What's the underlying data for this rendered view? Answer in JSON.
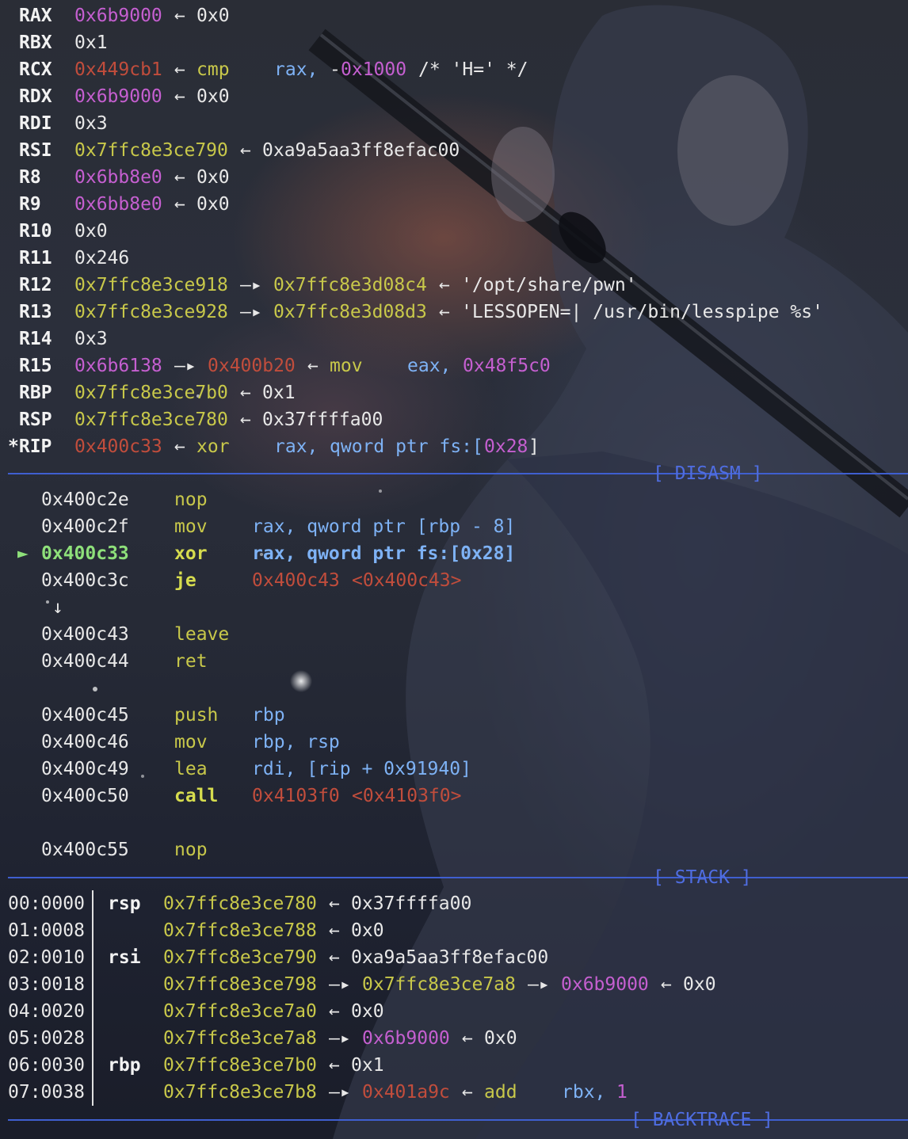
{
  "registers": [
    {
      "name": "RAX",
      "v": "0x6b9000",
      "a1": "←",
      "t1": "0x0"
    },
    {
      "name": "RBX",
      "v": "0x1"
    },
    {
      "name": "RCX",
      "v": "0x449cb1",
      "a1": "←",
      "ins": "cmp",
      "o1": "rax,",
      "o2": "-",
      "o3": "0x1000",
      "cm": "/* 'H=' */"
    },
    {
      "name": "RDX",
      "v": "0x6b9000",
      "a1": "←",
      "t1": "0x0"
    },
    {
      "name": "RDI",
      "v": "0x3"
    },
    {
      "name": "RSI",
      "v": "0x7ffc8e3ce790",
      "a1": "←",
      "t1": "0xa9a5aa3ff8efac00"
    },
    {
      "name": "R8",
      "v": "0x6bb8e0",
      "a1": "←",
      "t1": "0x0"
    },
    {
      "name": "R9",
      "v": "0x6bb8e0",
      "a1": "←",
      "t1": "0x0"
    },
    {
      "name": "R10",
      "v": "0x0"
    },
    {
      "name": "R11",
      "v": "0x246"
    },
    {
      "name": "R12",
      "v": "0x7ffc8e3ce918",
      "a1": "—▸",
      "v2": "0x7ffc8e3d08c4",
      "a2": "←",
      "s": "'/opt/share/pwn'"
    },
    {
      "name": "R13",
      "v": "0x7ffc8e3ce928",
      "a1": "—▸",
      "v2": "0x7ffc8e3d08d3",
      "a2": "←",
      "s": "'LESSOPEN=| /usr/bin/lesspipe %s'"
    },
    {
      "name": "R14",
      "v": "0x3"
    },
    {
      "name": "R15",
      "v": "0x6b6138",
      "a1": "—▸",
      "v2": "0x400b20",
      "a2": "←",
      "ins": "mov",
      "o1": "eax,",
      "o2": "0x48f5c0"
    },
    {
      "name": "RBP",
      "v": "0x7ffc8e3ce7b0",
      "a1": "←",
      "t1": "0x1"
    },
    {
      "name": "RSP",
      "v": "0x7ffc8e3ce780",
      "a1": "←",
      "t1": "0x37ffffa00"
    },
    {
      "name": "*RIP",
      "v": "0x400c33",
      "a1": "←",
      "ins": "xor",
      "o1": "rax,",
      "o2": "qword ptr fs:[",
      "o3": "0x28",
      "o4": "]"
    }
  ],
  "sections": {
    "disasm": "[ DISASM ]",
    "stack": "[ STACK ]",
    "backtrace": "[ BACKTRACE ]"
  },
  "disasm": [
    {
      "addr": "0x400c2e",
      "mn": "nop"
    },
    {
      "addr": "0x400c2f",
      "mn": "mov",
      "ops": "rax, qword ptr [rbp - 8]"
    },
    {
      "addr": "0x400c33",
      "mn": "xor",
      "ops": "rax, qword ptr fs:[0x28]",
      "current": true,
      "marker": "►"
    },
    {
      "addr": "0x400c3c",
      "mn": "je",
      "t": "0x400c43",
      "tl": "<0x400c43>"
    },
    {
      "arrow": "↓"
    },
    {
      "addr": "0x400c43",
      "mn": "leave"
    },
    {
      "addr": "0x400c44",
      "mn": "ret"
    },
    {
      "addr": "0x400c45",
      "mn": "push",
      "ops": "rbp"
    },
    {
      "addr": "0x400c46",
      "mn": "mov",
      "ops": "rbp, rsp"
    },
    {
      "addr": "0x400c49",
      "mn": "lea",
      "ops": "rdi, [rip + 0x91940]"
    },
    {
      "addr": "0x400c50",
      "mn": "call",
      "t": "0x4103f0",
      "tl": "<0x4103f0>"
    },
    {
      "addr": "0x400c55",
      "mn": "nop"
    }
  ],
  "stack": [
    {
      "off": "00:0000",
      "reg": "rsp",
      "a": "0x7ffc8e3ce780",
      "ar": "←",
      "v": "0x37ffffa00"
    },
    {
      "off": "01:0008",
      "reg": "",
      "a": "0x7ffc8e3ce788",
      "ar": "←",
      "v": "0x0"
    },
    {
      "off": "02:0010",
      "reg": "rsi",
      "a": "0x7ffc8e3ce790",
      "ar": "←",
      "v": "0xa9a5aa3ff8efac00"
    },
    {
      "off": "03:0018",
      "reg": "",
      "a": "0x7ffc8e3ce798",
      "ar": "—▸",
      "p": "0x7ffc8e3ce7a8",
      "ar2": "—▸",
      "m": "0x6b9000",
      "ar3": "←",
      "v": "0x0"
    },
    {
      "off": "04:0020",
      "reg": "",
      "a": "0x7ffc8e3ce7a0",
      "ar": "←",
      "v": "0x0"
    },
    {
      "off": "05:0028",
      "reg": "",
      "a": "0x7ffc8e3ce7a8",
      "ar": "—▸",
      "m": "0x6b9000",
      "ar3": "←",
      "v": "0x0"
    },
    {
      "off": "06:0030",
      "reg": "rbp",
      "a": "0x7ffc8e3ce7b0",
      "ar": "←",
      "v": "0x1"
    },
    {
      "off": "07:0038",
      "reg": "",
      "a": "0x7ffc8e3ce7b8",
      "ar": "—▸",
      "r": "0x401a9c",
      "ar3": "←",
      "ins": "add",
      "ops1": "rbx,",
      "ops2": "1"
    }
  ],
  "colors": {
    "separator": "#3f5fd0",
    "magenta": "#c55fd0",
    "yellow": "#c8c84a",
    "red": "#c14d3c",
    "blue": "#7eb2f5",
    "green": "#8ee07a"
  }
}
